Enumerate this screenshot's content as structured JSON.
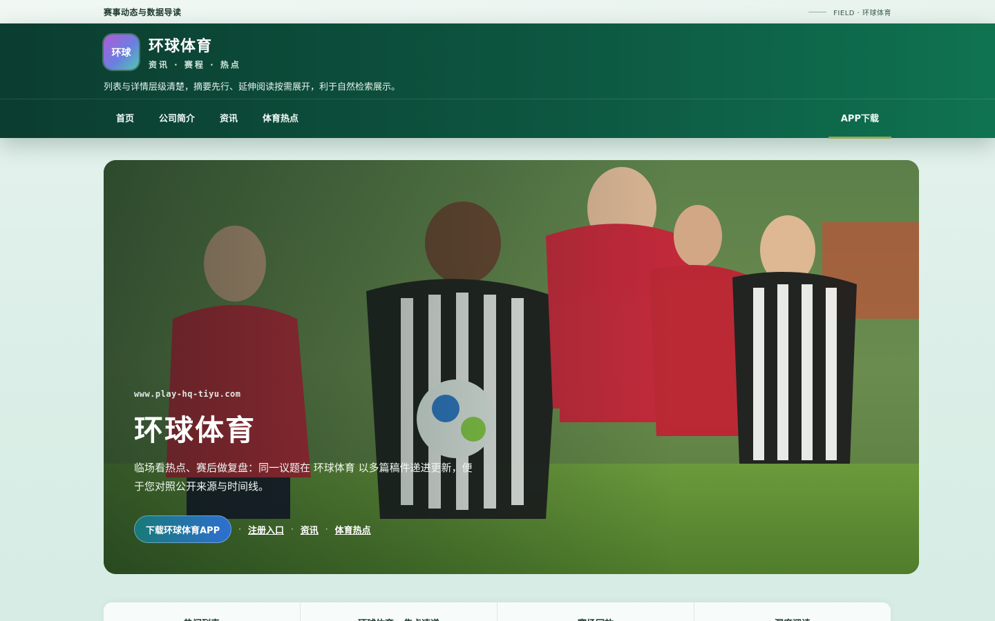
{
  "topbar": {
    "tagline": "赛事动态与数据导读",
    "field_label": "FIELD · 环球体育"
  },
  "brand": {
    "logo_text": "环球",
    "name": "环球体育",
    "sub": "资讯 · 赛程 · 热点",
    "description": "列表与详情层级清楚，摘要先行、延伸阅读按需展开，利于自然检索展示。"
  },
  "nav": {
    "items": [
      {
        "label": "首页"
      },
      {
        "label": "公司简介"
      },
      {
        "label": "资讯"
      },
      {
        "label": "体育热点"
      }
    ],
    "right": {
      "label": "APP下载"
    }
  },
  "hero": {
    "url": "www.play-hq-tiyu.com",
    "title": "环球体育",
    "description": "临场看热点、赛后做复盘：同一议题在 环球体育 以多篇稿件递进更新，便于您对照公开来源与时间线。",
    "cta_label": "下载环球体育APP",
    "links": [
      {
        "label": "注册入口"
      },
      {
        "label": "资讯"
      },
      {
        "label": "体育热点"
      }
    ]
  },
  "cards": [
    {
      "label": "热门列表"
    },
    {
      "label": "环球体育 · 焦点速递"
    },
    {
      "label": "赛场回放"
    },
    {
      "label": "深度阅读"
    }
  ],
  "colors": {
    "header_dark": "#0b3d30",
    "header_light": "#0f7351",
    "accent_underline": "#9aa85a",
    "cta_start": "#187a78",
    "cta_end": "#2e6fd0"
  }
}
